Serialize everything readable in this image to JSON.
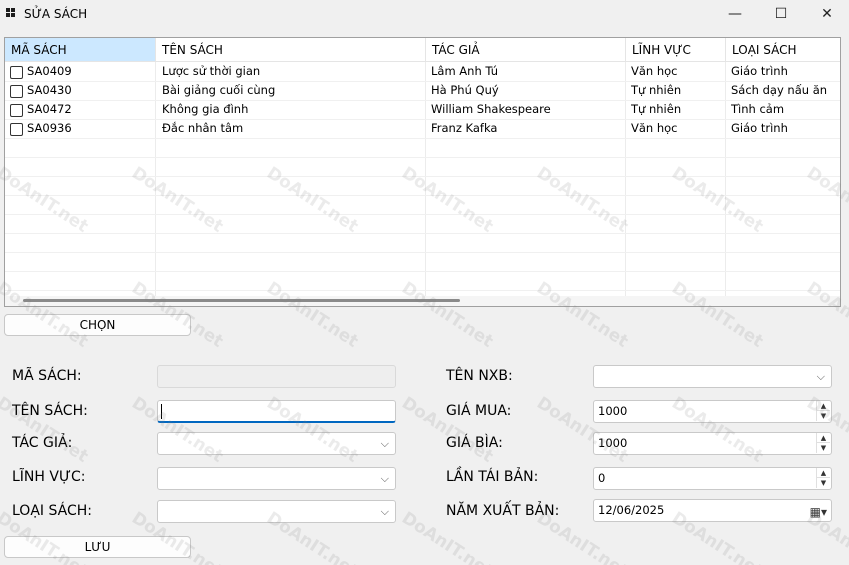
{
  "window": {
    "title": "SỬA SÁCH",
    "minimize_glyph": "—",
    "maximize_glyph": "☐",
    "close_glyph": "✕"
  },
  "grid": {
    "columns": [
      "MÃ SÁCH",
      "TÊN SÁCH",
      "TÁC GIẢ",
      "LĨNH VỰC",
      "LOẠI SÁCH"
    ],
    "rows": [
      {
        "ma": "SA0409",
        "ten": "Lược sử thời gian",
        "tacgia": "Lâm Anh Tú",
        "linhvuc": "Văn học",
        "loai": "Giáo trình"
      },
      {
        "ma": "SA0430",
        "ten": "Bài giảng cuối cùng",
        "tacgia": "Hà Phú Quý",
        "linhvuc": "Tự nhiên",
        "loai": "Sách dạy nấu ăn"
      },
      {
        "ma": "SA0472",
        "ten": "Không gia đình",
        "tacgia": "William Shakespeare",
        "linhvuc": "Tự nhiên",
        "loai": "Tình cảm"
      },
      {
        "ma": "SA0936",
        "ten": "Đắc nhân tâm",
        "tacgia": "Franz Kafka",
        "linhvuc": "Văn học",
        "loai": "Giáo trình"
      }
    ]
  },
  "buttons": {
    "chon": "CHỌN",
    "luu": "LƯU"
  },
  "form": {
    "ma_sach": {
      "label": "MÃ SÁCH:",
      "value": ""
    },
    "ten_sach": {
      "label": "TÊN SÁCH:",
      "value": ""
    },
    "tac_gia": {
      "label": "TÁC GIẢ:",
      "value": ""
    },
    "linh_vuc": {
      "label": "LĨNH VỰC:",
      "value": ""
    },
    "loai_sach": {
      "label": "LOẠI SÁCH:",
      "value": ""
    },
    "ten_nxb": {
      "label": "TÊN NXB:",
      "value": ""
    },
    "gia_mua": {
      "label": "GIÁ MUA:",
      "value": "1000"
    },
    "gia_bia": {
      "label": "GIÁ BÌA:",
      "value": "1000"
    },
    "lan_tai_ban": {
      "label": "LẦN TÁI BẢN:",
      "value": "0"
    },
    "nam_xuat_ban": {
      "label": "NĂM XUẤT BẢN:",
      "value": "12/06/2025"
    }
  },
  "watermark": {
    "text": "DoAnIT.net"
  },
  "icons": {
    "dropdown": "chevron-down-icon",
    "spin": "spin-arrows-icon",
    "calendar": "calendar-icon"
  }
}
